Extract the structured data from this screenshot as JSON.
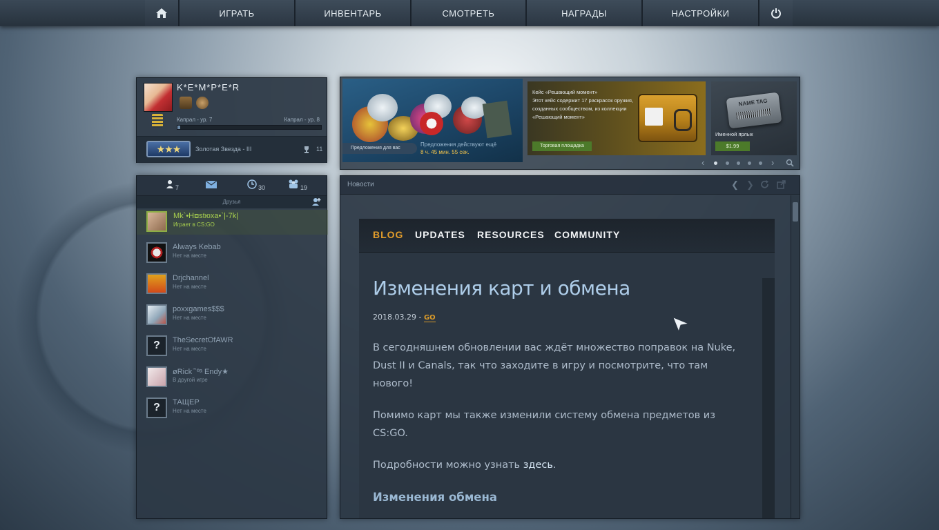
{
  "nav": {
    "home_icon": "home-icon",
    "items": [
      "ИГРАТЬ",
      "ИНВЕНТАРЬ",
      "СМОТРЕТЬ",
      "НАГРАДЫ",
      "НАСТРОЙКИ"
    ],
    "power_icon": "power-icon"
  },
  "profile": {
    "username": "K*E*M*P*E*R",
    "rank_current": "Капрал - ур. 7",
    "rank_next": "Капрал - ур. 8",
    "xp_progress": 0.02,
    "skill_group": "Золотая Звезда - III",
    "skill_stars": "★★★",
    "trophies": "11"
  },
  "friends": {
    "tabs": [
      {
        "icon": "person-icon",
        "count": "7"
      },
      {
        "icon": "mail-icon",
        "count": ""
      },
      {
        "icon": "clock-icon",
        "count": "30"
      },
      {
        "icon": "group-icon",
        "count": "19"
      }
    ],
    "header": "Друзья",
    "list": [
      {
        "name": "Mk`•H⧈stюxa•`|-7k|",
        "status": "Играет в CS:GO",
        "online": true
      },
      {
        "name": "Always Kebab",
        "status": "Нет на месте"
      },
      {
        "name": "Drjchannel",
        "status": "Нет на месте"
      },
      {
        "name": "poxxgames$$$",
        "status": "Нет на месте"
      },
      {
        "name": "TheSecretOfAWR",
        "status": "Нет на месте",
        "avatar": "?"
      },
      {
        "name": "øRick ̄`ºᵃ Endy★",
        "status": "В другой игре"
      },
      {
        "name": "ТАЩЕР",
        "status": "Нет на месте",
        "avatar": "?"
      }
    ]
  },
  "store": {
    "featured_tag": "Предложения для вас",
    "timer_label": "Предложения действуют ещё",
    "timer": "8 ч.  45 мин. 55 сек.",
    "case_desc": "Кейс «Решающий момент»\nЭтот кейс содержит 17 раскрасок оружия, созданных сообществом, из коллекции «Решающий момент»",
    "market_button": "Торговая площадка",
    "name_tag_text": "NAME TAG",
    "name_tag_item": "Именной ярлык",
    "name_tag_price": "$1.99"
  },
  "news": {
    "header": "Новости",
    "blog_nav": [
      "BLOG",
      "UPDATES",
      "RESOURCES",
      "COMMUNITY"
    ],
    "title": "Изменения карт и обмена",
    "date": "2018.03.29 - ",
    "tag": "GO",
    "p1": "В сегодняшнем обновлении вас ждёт множество поправок на Nuke, Dust II и Canals, так что заходите в игру и посмотрите, что там нового!",
    "p2": "Помимо карт мы также изменили систему обмена предметов из CS:GO.",
    "p3_pre": "Подробности можно узнать ",
    "p3_link": "здесь",
    "p3_post": ".",
    "h2": "Изменения обмена"
  },
  "colors": {
    "accent_orange": "#e39d2b",
    "online_green": "#a9d14e",
    "price_green": "#4c7a2a"
  }
}
